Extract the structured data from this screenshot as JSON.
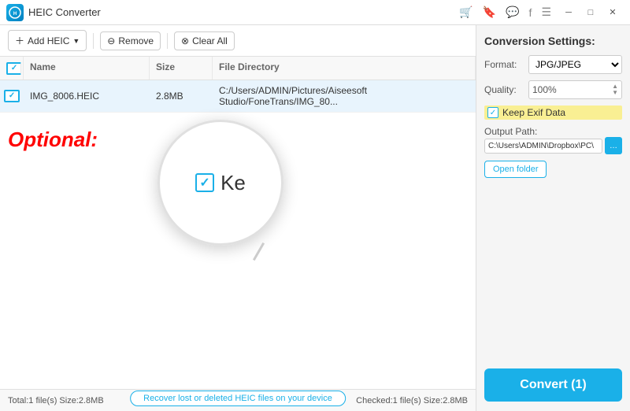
{
  "titlebar": {
    "logo": "HEIC",
    "title": "HEIC Converter",
    "icons": [
      "cart",
      "bookmark",
      "chat",
      "facebook",
      "menu"
    ],
    "controls": [
      "minimize",
      "maximize",
      "close"
    ]
  },
  "toolbar": {
    "add_label": "Add HEIC",
    "remove_label": "Remove",
    "clear_label": "Clear All"
  },
  "table": {
    "headers": [
      "",
      "Name",
      "Size",
      "File Directory"
    ],
    "rows": [
      {
        "checked": true,
        "name": "IMG_8006.HEIC",
        "size": "2.8MB",
        "directory": "C:/Users/ADMIN/Pictures/Aiseesoft Studio/FoneTrans/IMG_80..."
      }
    ]
  },
  "optional_label": "Optional:",
  "magnifier": {
    "checkbox_label": "Ke"
  },
  "settings": {
    "title": "Conversion Settings:",
    "format_label": "Format:",
    "format_value": "JPG/JPEG",
    "quality_label": "Quality:",
    "quality_value": "100%",
    "keep_exif_label": "Keep Exif Data",
    "output_path_label": "Output Path:",
    "output_path_value": "C:\\Users\\ADMIN\\Dropbox\\PC\\",
    "open_folder_label": "Open folder",
    "convert_label": "Convert (1)"
  },
  "status": {
    "total": "Total:1 file(s) Size:2.8MB",
    "checked": "Checked:1 file(s) Size:2.8MB"
  },
  "recover_label": "Recover lost or deleted HEIC files on your device"
}
